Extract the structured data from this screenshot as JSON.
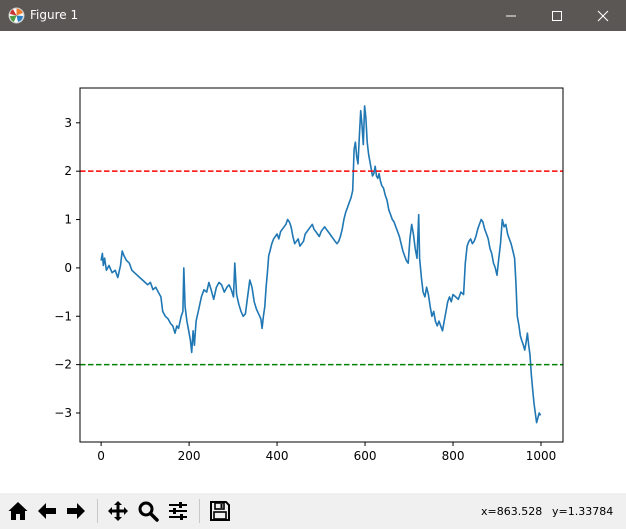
{
  "window": {
    "title": "Figure 1",
    "icons": {
      "app": "matplotlib-figure-icon",
      "minimize": "minimize-icon",
      "maximize": "maximize-icon",
      "close": "close-icon"
    }
  },
  "toolbar": {
    "buttons": [
      {
        "name": "home-button",
        "icon": "home-icon"
      },
      {
        "name": "back-button",
        "icon": "arrow-left-icon"
      },
      {
        "name": "forward-button",
        "icon": "arrow-right-icon"
      },
      {
        "name": "pan-button",
        "icon": "move-icon"
      },
      {
        "name": "zoom-button",
        "icon": "zoom-icon"
      },
      {
        "name": "subplots-button",
        "icon": "sliders-icon"
      },
      {
        "name": "save-button",
        "icon": "save-icon"
      }
    ],
    "coord_x": "x=863.528",
    "coord_y": "y=1.33784"
  },
  "colors": {
    "line": "#1f77b4",
    "upper": "#ff0000",
    "lower": "#008000",
    "titlebar": "#5b5754",
    "toolbar": "#f0f0f0"
  },
  "chart_data": {
    "type": "line",
    "title": "",
    "xlabel": "",
    "ylabel": "",
    "xlim": [
      -48,
      1050
    ],
    "ylim": [
      -3.6,
      3.72
    ],
    "xticks": [
      0,
      200,
      400,
      600,
      800,
      1000
    ],
    "yticks": [
      -3,
      -2,
      -1,
      0,
      1,
      2,
      3
    ],
    "grid": false,
    "hlines": [
      {
        "y": 2,
        "color": "#ff0000",
        "style": "dashed"
      },
      {
        "y": -2,
        "color": "#008000",
        "style": "dashed"
      }
    ],
    "series": [
      {
        "color": "#1f77b4",
        "points": [
          [
            0,
            0.15
          ],
          [
            3,
            0.3
          ],
          [
            5,
            0.05
          ],
          [
            8,
            0.2
          ],
          [
            12,
            -0.05
          ],
          [
            18,
            0.05
          ],
          [
            25,
            -0.1
          ],
          [
            32,
            -0.05
          ],
          [
            38,
            -0.2
          ],
          [
            44,
            0.05
          ],
          [
            48,
            0.35
          ],
          [
            52,
            0.25
          ],
          [
            58,
            0.15
          ],
          [
            64,
            0.1
          ],
          [
            70,
            -0.05
          ],
          [
            76,
            -0.1
          ],
          [
            82,
            -0.15
          ],
          [
            88,
            -0.2
          ],
          [
            94,
            -0.25
          ],
          [
            100,
            -0.3
          ],
          [
            106,
            -0.35
          ],
          [
            112,
            -0.3
          ],
          [
            118,
            -0.45
          ],
          [
            124,
            -0.4
          ],
          [
            130,
            -0.5
          ],
          [
            136,
            -0.6
          ],
          [
            140,
            -0.9
          ],
          [
            146,
            -1.0
          ],
          [
            152,
            -1.05
          ],
          [
            158,
            -1.15
          ],
          [
            163,
            -1.2
          ],
          [
            168,
            -1.35
          ],
          [
            172,
            -1.2
          ],
          [
            176,
            -1.25
          ],
          [
            182,
            -1.0
          ],
          [
            186,
            -0.9
          ],
          [
            188,
            0.0
          ],
          [
            191,
            -0.8
          ],
          [
            195,
            -1.1
          ],
          [
            199,
            -1.3
          ],
          [
            203,
            -1.5
          ],
          [
            206,
            -1.75
          ],
          [
            209,
            -1.3
          ],
          [
            212,
            -1.6
          ],
          [
            216,
            -1.1
          ],
          [
            222,
            -0.85
          ],
          [
            228,
            -0.6
          ],
          [
            234,
            -0.45
          ],
          [
            240,
            -0.5
          ],
          [
            245,
            -0.3
          ],
          [
            250,
            -0.45
          ],
          [
            256,
            -0.65
          ],
          [
            262,
            -0.4
          ],
          [
            268,
            -0.3
          ],
          [
            274,
            -0.35
          ],
          [
            280,
            -0.5
          ],
          [
            286,
            -0.4
          ],
          [
            291,
            -0.35
          ],
          [
            296,
            -0.45
          ],
          [
            301,
            -0.6
          ],
          [
            304,
            0.1
          ],
          [
            308,
            -0.55
          ],
          [
            313,
            -0.75
          ],
          [
            318,
            -0.9
          ],
          [
            323,
            -1.0
          ],
          [
            328,
            -0.95
          ],
          [
            333,
            -0.6
          ],
          [
            338,
            -0.25
          ],
          [
            343,
            -0.4
          ],
          [
            348,
            -0.7
          ],
          [
            353,
            -0.85
          ],
          [
            358,
            -0.95
          ],
          [
            363,
            -1.05
          ],
          [
            366,
            -1.25
          ],
          [
            369,
            -1.0
          ],
          [
            372,
            -0.8
          ],
          [
            375,
            -0.4
          ],
          [
            378,
            -0.1
          ],
          [
            381,
            0.25
          ],
          [
            384,
            0.35
          ],
          [
            388,
            0.5
          ],
          [
            392,
            0.6
          ],
          [
            396,
            0.65
          ],
          [
            400,
            0.7
          ],
          [
            404,
            0.6
          ],
          [
            408,
            0.75
          ],
          [
            412,
            0.8
          ],
          [
            416,
            0.85
          ],
          [
            420,
            0.9
          ],
          [
            424,
            1.0
          ],
          [
            428,
            0.95
          ],
          [
            432,
            0.85
          ],
          [
            436,
            0.65
          ],
          [
            440,
            0.5
          ],
          [
            444,
            0.55
          ],
          [
            448,
            0.6
          ],
          [
            452,
            0.45
          ],
          [
            456,
            0.5
          ],
          [
            460,
            0.55
          ],
          [
            464,
            0.7
          ],
          [
            468,
            0.75
          ],
          [
            472,
            0.8
          ],
          [
            476,
            0.85
          ],
          [
            480,
            0.9
          ],
          [
            484,
            0.8
          ],
          [
            488,
            0.75
          ],
          [
            492,
            0.7
          ],
          [
            496,
            0.65
          ],
          [
            500,
            0.75
          ],
          [
            504,
            0.8
          ],
          [
            508,
            0.85
          ],
          [
            512,
            0.8
          ],
          [
            516,
            0.75
          ],
          [
            520,
            0.7
          ],
          [
            524,
            0.65
          ],
          [
            528,
            0.6
          ],
          [
            532,
            0.55
          ],
          [
            536,
            0.5
          ],
          [
            540,
            0.55
          ],
          [
            544,
            0.65
          ],
          [
            548,
            0.8
          ],
          [
            552,
            1.0
          ],
          [
            556,
            1.15
          ],
          [
            560,
            1.25
          ],
          [
            564,
            1.35
          ],
          [
            568,
            1.45
          ],
          [
            572,
            1.6
          ],
          [
            575,
            2.45
          ],
          [
            578,
            2.6
          ],
          [
            581,
            2.3
          ],
          [
            584,
            2.15
          ],
          [
            587,
            2.7
          ],
          [
            590,
            3.25
          ],
          [
            593,
            2.95
          ],
          [
            596,
            2.55
          ],
          [
            599,
            3.35
          ],
          [
            602,
            3.1
          ],
          [
            605,
            2.6
          ],
          [
            608,
            2.35
          ],
          [
            611,
            2.2
          ],
          [
            614,
            2.05
          ],
          [
            617,
            1.9
          ],
          [
            620,
            1.95
          ],
          [
            623,
            2.1
          ],
          [
            626,
            1.9
          ],
          [
            629,
            1.85
          ],
          [
            632,
            1.95
          ],
          [
            635,
            1.8
          ],
          [
            638,
            1.7
          ],
          [
            642,
            1.65
          ],
          [
            646,
            1.5
          ],
          [
            650,
            1.4
          ],
          [
            654,
            1.2
          ],
          [
            658,
            1.1
          ],
          [
            662,
            1.0
          ],
          [
            666,
            0.95
          ],
          [
            670,
            0.85
          ],
          [
            674,
            0.75
          ],
          [
            678,
            0.65
          ],
          [
            682,
            0.5
          ],
          [
            686,
            0.35
          ],
          [
            690,
            0.25
          ],
          [
            694,
            0.15
          ],
          [
            698,
            0.1
          ],
          [
            702,
            0.6
          ],
          [
            706,
            0.9
          ],
          [
            710,
            0.7
          ],
          [
            714,
            0.4
          ],
          [
            718,
            0.2
          ],
          [
            722,
            1.1
          ],
          [
            724,
            0.2
          ],
          [
            728,
            -0.2
          ],
          [
            732,
            -0.5
          ],
          [
            736,
            -0.6
          ],
          [
            740,
            -0.4
          ],
          [
            744,
            -0.55
          ],
          [
            748,
            -0.8
          ],
          [
            752,
            -1.0
          ],
          [
            756,
            -0.9
          ],
          [
            760,
            -1.1
          ],
          [
            764,
            -1.2
          ],
          [
            768,
            -1.1
          ],
          [
            772,
            -1.2
          ],
          [
            776,
            -1.3
          ],
          [
            780,
            -1.1
          ],
          [
            784,
            -0.9
          ],
          [
            788,
            -0.7
          ],
          [
            792,
            -0.6
          ],
          [
            796,
            -0.7
          ],
          [
            800,
            -0.55
          ],
          [
            806,
            -0.6
          ],
          [
            812,
            -0.65
          ],
          [
            818,
            -0.5
          ],
          [
            824,
            -0.55
          ],
          [
            828,
            0.1
          ],
          [
            832,
            0.45
          ],
          [
            836,
            0.55
          ],
          [
            840,
            0.6
          ],
          [
            844,
            0.5
          ],
          [
            848,
            0.55
          ],
          [
            852,
            0.65
          ],
          [
            856,
            0.8
          ],
          [
            860,
            0.9
          ],
          [
            864,
            1.0
          ],
          [
            868,
            0.95
          ],
          [
            872,
            0.8
          ],
          [
            876,
            0.7
          ],
          [
            880,
            0.6
          ],
          [
            884,
            0.4
          ],
          [
            888,
            0.3
          ],
          [
            892,
            0.1
          ],
          [
            896,
            0.0
          ],
          [
            900,
            -0.15
          ],
          [
            904,
            0.2
          ],
          [
            908,
            0.5
          ],
          [
            912,
            1.0
          ],
          [
            916,
            0.85
          ],
          [
            920,
            0.9
          ],
          [
            924,
            0.7
          ],
          [
            928,
            0.6
          ],
          [
            932,
            0.5
          ],
          [
            936,
            0.35
          ],
          [
            940,
            0.2
          ],
          [
            943,
            -0.3
          ],
          [
            946,
            -1.0
          ],
          [
            950,
            -1.2
          ],
          [
            953,
            -1.4
          ],
          [
            956,
            -1.5
          ],
          [
            960,
            -1.6
          ],
          [
            963,
            -1.7
          ],
          [
            966,
            -1.55
          ],
          [
            969,
            -1.35
          ],
          [
            972,
            -1.6
          ],
          [
            975,
            -1.8
          ],
          [
            978,
            -2.2
          ],
          [
            981,
            -2.5
          ],
          [
            984,
            -2.8
          ],
          [
            987,
            -3.0
          ],
          [
            990,
            -3.2
          ],
          [
            993,
            -3.1
          ],
          [
            996,
            -3.0
          ],
          [
            999,
            -3.05
          ]
        ]
      }
    ]
  }
}
